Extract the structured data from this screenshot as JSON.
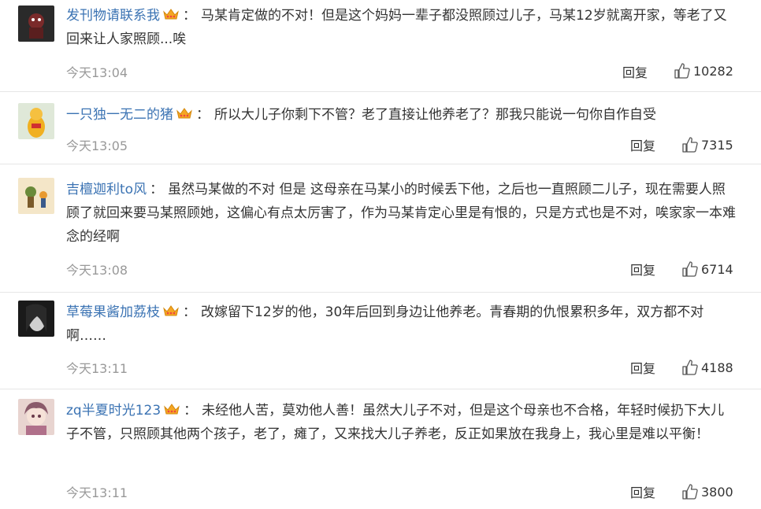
{
  "comments": [
    {
      "username": "发刊物请联系我",
      "colon": "：",
      "text": "马某肯定做的不对！但是这个妈妈一辈子都没照顾过儿子，马某12岁就离开家，等老了又回来让人家照顾...唉",
      "time": "今天13:04",
      "reply_label": "回复",
      "likes": "10282",
      "crown": true
    },
    {
      "username": "一只独一无二的猪",
      "colon": "：",
      "text": "所以大儿子你剩下不管？老了直接让他养老了？那我只能说一句你自作自受",
      "time": "今天13:05",
      "reply_label": "回复",
      "likes": "7315",
      "crown": true
    },
    {
      "username": "吉檀迦利to风",
      "colon": "：",
      "text": "虽然马某做的不对 但是 这母亲在马某小的时候丢下他，之后也一直照顾二儿子，现在需要人照顾了就回来要马某照顾她，这偏心有点太厉害了，作为马某肯定心里是有恨的，只是方式也是不对，唉家家一本难念的经啊",
      "time": "今天13:08",
      "reply_label": "回复",
      "likes": "6714",
      "crown": false
    },
    {
      "username": "草莓果酱加荔枝",
      "colon": "：",
      "text": "改嫁留下12岁的他，30年后回到身边让他养老。青春期的仇恨累积多年，双方都不对啊……",
      "time": "今天13:11",
      "reply_label": "回复",
      "likes": "4188",
      "crown": true
    },
    {
      "username": "zq半夏时光123",
      "colon": "：",
      "text": "未经他人苦，莫劝他人善！虽然大儿子不对，但是这个母亲也不合格，年轻时候扔下大儿子不管，只照顾其他两个孩子，老了，瘫了，又来找大儿子养老，反正如果放在我身上，我心里是难以平衡！",
      "time": "今天13:11",
      "reply_label": "回复",
      "likes": "3800",
      "crown": true
    }
  ],
  "colors": {
    "username": "#3b73b3",
    "time": "#999999",
    "text": "#333333",
    "crown": "#f5a623"
  },
  "icons": {
    "like": "thumbs-up-icon",
    "crown": "crown-icon"
  }
}
